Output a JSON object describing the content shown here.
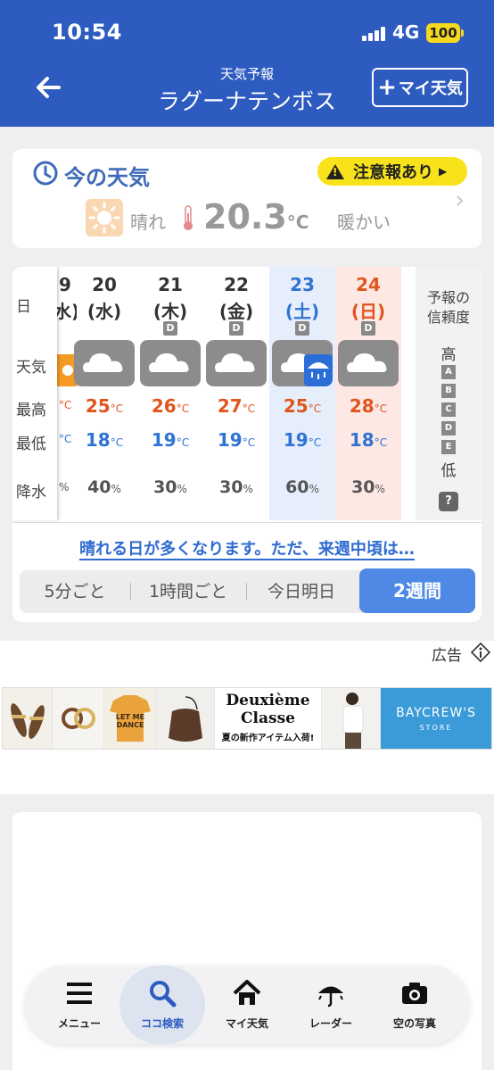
{
  "status": {
    "time": "10:54",
    "network": "4G",
    "battery": "100"
  },
  "header": {
    "subtitle": "天気予報",
    "title": "ラグーナテンボス",
    "my_button": "マイ天気",
    "my_button_plus": "+"
  },
  "now": {
    "title": "今の天気",
    "alert": "注意報あり",
    "condition": "晴れ",
    "temp": "20.3",
    "temp_unit": "°C",
    "feel": "暖かい"
  },
  "forecast": {
    "row_labels": {
      "day": "日",
      "weather": "天気",
      "high": "最高",
      "low": "最低",
      "precip": "降水"
    },
    "partial": {
      "date": "9",
      "dow": "水)",
      "hi": "°C",
      "lo": "°C",
      "precip": "%"
    },
    "unit_temp": "°C",
    "unit_pct": "%",
    "days": [
      {
        "date": "20",
        "dow": "(水)",
        "rel": "",
        "weather": "cloudy",
        "hi": "25",
        "lo": "18",
        "precip": "40",
        "color": "#333333"
      },
      {
        "date": "21",
        "dow": "(木)",
        "rel": "D",
        "weather": "cloudy",
        "hi": "26",
        "lo": "19",
        "precip": "30",
        "color": "#333333"
      },
      {
        "date": "22",
        "dow": "(金)",
        "rel": "D",
        "weather": "cloudy",
        "hi": "27",
        "lo": "19",
        "precip": "30",
        "color": "#333333"
      },
      {
        "date": "23",
        "dow": "(土)",
        "rel": "D",
        "weather": "cloudy-then-rain",
        "hi": "25",
        "lo": "19",
        "precip": "60",
        "color": "#2f73d4"
      },
      {
        "date": "24",
        "dow": "(日)",
        "rel": "D",
        "weather": "cloudy",
        "hi": "28",
        "lo": "18",
        "precip": "30",
        "color": "#e0561f"
      }
    ],
    "reliability": {
      "title_1": "予報の",
      "title_2": "信頼度",
      "high": "高",
      "low": "低",
      "grades": [
        "A",
        "B",
        "C",
        "D",
        "E"
      ],
      "help": "?"
    },
    "summary": "晴れる日が多くなります。ただ、来週中頃は…",
    "tabs": [
      "5分ごと",
      "1時間ごと",
      "今日明日",
      "2週間"
    ],
    "active_tab": "2週間"
  },
  "ad": {
    "label": "広告",
    "tshirt_text": "LET ME DANCE",
    "brand_title": "Deuxième Classe",
    "brand_sub": "夏の新作アイテム入荷!",
    "store_title": "BAYCREW'S",
    "store_sub": "STORE"
  },
  "tabbar": [
    {
      "label": "メニュー",
      "icon": "menu-icon"
    },
    {
      "label": "ココ検索",
      "icon": "search-icon"
    },
    {
      "label": "マイ天気",
      "icon": "home-icon"
    },
    {
      "label": "レーダー",
      "icon": "umbrella-icon"
    },
    {
      "label": "空の写真",
      "icon": "camera-icon"
    }
  ],
  "colors": {
    "header": "#2d5bbf",
    "high_temp": "#e0561f",
    "low_temp": "#2f73d4",
    "alert": "#f8e219",
    "active_seg": "#4f89e6"
  }
}
